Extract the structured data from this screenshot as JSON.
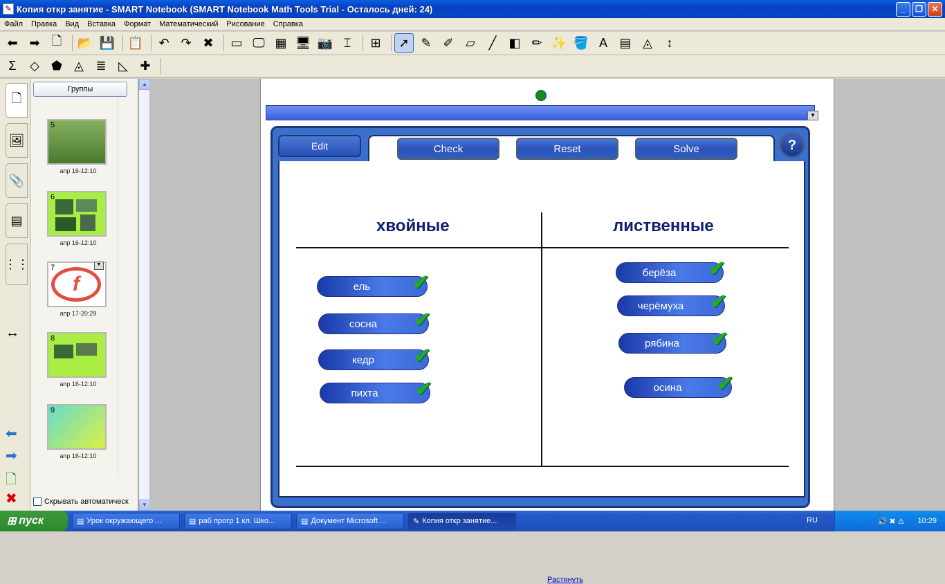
{
  "window": {
    "title": "Копия откр занятие - SMART Notebook (SMART Notebook Math Tools Trial - Осталось дней: 24)"
  },
  "menu": [
    "Файл",
    "Правка",
    "Вид",
    "Вставка",
    "Формат",
    "Математический",
    "Рисование",
    "Справка"
  ],
  "toolbar1": [
    {
      "name": "back-arrow-icon",
      "glyph": "⬅"
    },
    {
      "name": "forward-arrow-icon",
      "glyph": "➡"
    },
    {
      "name": "add-page-icon",
      "glyph": "🗋"
    },
    {
      "name": "open-folder-icon",
      "glyph": "📂"
    },
    {
      "name": "save-icon",
      "glyph": "💾"
    },
    {
      "name": "paste-icon",
      "glyph": "📋"
    },
    {
      "name": "undo-icon",
      "glyph": "↶"
    },
    {
      "name": "redo-icon",
      "glyph": "↷"
    },
    {
      "name": "delete-icon",
      "glyph": "✖"
    },
    {
      "name": "screen-shade-icon",
      "glyph": "▭"
    },
    {
      "name": "full-screen-icon",
      "glyph": "🖵"
    },
    {
      "name": "transparent-bg-icon",
      "glyph": "▦"
    },
    {
      "name": "display-icon",
      "glyph": "🖥"
    },
    {
      "name": "capture-icon",
      "glyph": "📷"
    },
    {
      "name": "document-camera-icon",
      "glyph": "⌶"
    },
    {
      "name": "table-icon",
      "glyph": "⊞"
    },
    {
      "name": "select-arrow-icon",
      "glyph": "➚"
    },
    {
      "name": "pen-icon",
      "glyph": "✎"
    },
    {
      "name": "creative-pen-icon",
      "glyph": "✐"
    },
    {
      "name": "eraser-icon",
      "glyph": "▱"
    },
    {
      "name": "line-icon",
      "glyph": "╱"
    },
    {
      "name": "shapes-icon",
      "glyph": "◧"
    },
    {
      "name": "shape-pen-icon",
      "glyph": "✏"
    },
    {
      "name": "magic-pen-icon",
      "glyph": "✨"
    },
    {
      "name": "fill-icon",
      "glyph": "🪣"
    },
    {
      "name": "text-icon",
      "glyph": "A"
    },
    {
      "name": "properties-icon",
      "glyph": "▤"
    },
    {
      "name": "measurement-icon",
      "glyph": "◬"
    },
    {
      "name": "move-toolbar-icon",
      "glyph": "↕"
    }
  ],
  "toolbar2": [
    {
      "name": "sigma-icon",
      "glyph": "Σ"
    },
    {
      "name": "shape-builder-icon",
      "glyph": "◇"
    },
    {
      "name": "polygon-icon",
      "glyph": "⬟"
    },
    {
      "name": "compass-icon",
      "glyph": "◬"
    },
    {
      "name": "equation-icon",
      "glyph": "≣"
    },
    {
      "name": "graph-icon",
      "glyph": "◺"
    },
    {
      "name": "math-tools-icon",
      "glyph": "✚"
    }
  ],
  "sidebar": {
    "groups_label": "Группы",
    "auto_hide": "Скрывать автоматическ",
    "thumbnails": [
      {
        "num": "5",
        "date": "апр 16-12:10"
      },
      {
        "num": "6",
        "date": "апр 16-12:10"
      },
      {
        "num": "7",
        "date": "апр 17-20:29"
      },
      {
        "num": "8",
        "date": "апр 16-12:10"
      },
      {
        "num": "9",
        "date": "апр 16-12:10"
      }
    ]
  },
  "widget": {
    "edit": "Edit",
    "check": "Check",
    "reset": "Reset",
    "solve": "Solve",
    "help": "?",
    "col_left": "хвойные",
    "col_right": "лиственные",
    "left_items": [
      "ель",
      "сосна",
      "кедр",
      "пихта"
    ],
    "right_items": [
      "берёза",
      "черёмуха",
      "рябина",
      "осина"
    ],
    "stretch": "Растянуть"
  },
  "taskbar": {
    "start": "пуск",
    "tasks": [
      "Урок окружающего ...",
      "раб прогр 1 кл. Шко...",
      "Документ Microsoft ...",
      "Копия откр занятие..."
    ],
    "lang": "RU",
    "time": "10:29"
  }
}
